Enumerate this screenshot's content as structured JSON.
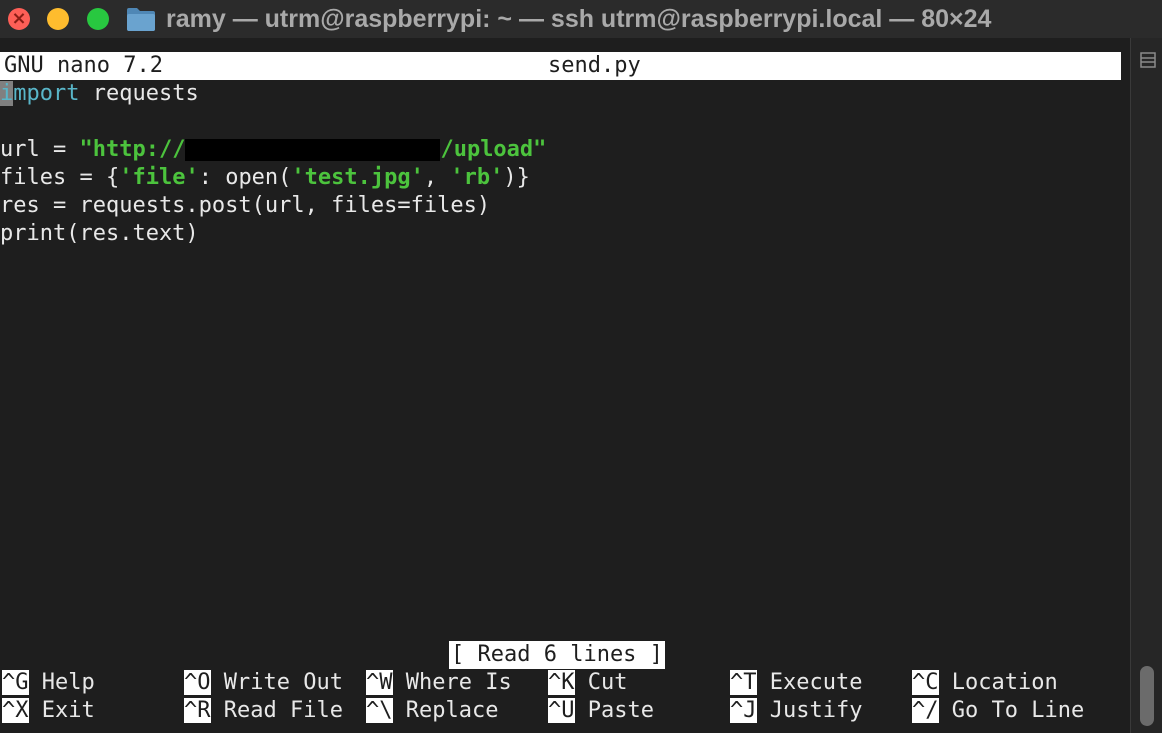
{
  "window": {
    "title": "ramy — utrm@raspberrypi: ~ — ssh utrm@raspberrypi.local — 80×24",
    "colors": {
      "close": "#fe5f57",
      "minimize": "#febc2e",
      "maximize": "#28c840"
    }
  },
  "nano": {
    "version_label": "GNU nano 7.2",
    "filename": "send.py",
    "status_message": "[ Read 6 lines ]"
  },
  "code": {
    "line1": {
      "keyword_first": "i",
      "keyword_rest": "mport",
      "rest": " requests"
    },
    "line3": {
      "prefix": "url = ",
      "str_start": "\"http://",
      "str_end": "/upload\""
    },
    "line4": {
      "p1": "files = {",
      "s1": "'file'",
      "p2": ": open(",
      "s2": "'test.jpg'",
      "p3": ", ",
      "s3": "'rb'",
      "p4": ")}"
    },
    "line5": "res = requests.post(url, files=files)",
    "line6": "print(res.text)"
  },
  "shortcuts": [
    {
      "key": "^G",
      "label": "Help"
    },
    {
      "key": "^O",
      "label": "Write Out"
    },
    {
      "key": "^W",
      "label": "Where Is"
    },
    {
      "key": "^K",
      "label": "Cut"
    },
    {
      "key": "^T",
      "label": "Execute"
    },
    {
      "key": "^C",
      "label": "Location"
    },
    {
      "key": "^X",
      "label": "Exit"
    },
    {
      "key": "^R",
      "label": "Read File"
    },
    {
      "key": "^\\",
      "label": "Replace"
    },
    {
      "key": "^U",
      "label": "Paste"
    },
    {
      "key": "^J",
      "label": "Justify"
    },
    {
      "key": "^/",
      "label": "Go To Line"
    }
  ],
  "icons": {
    "folder": "folder-icon",
    "split_pane": "split-pane-icon"
  }
}
